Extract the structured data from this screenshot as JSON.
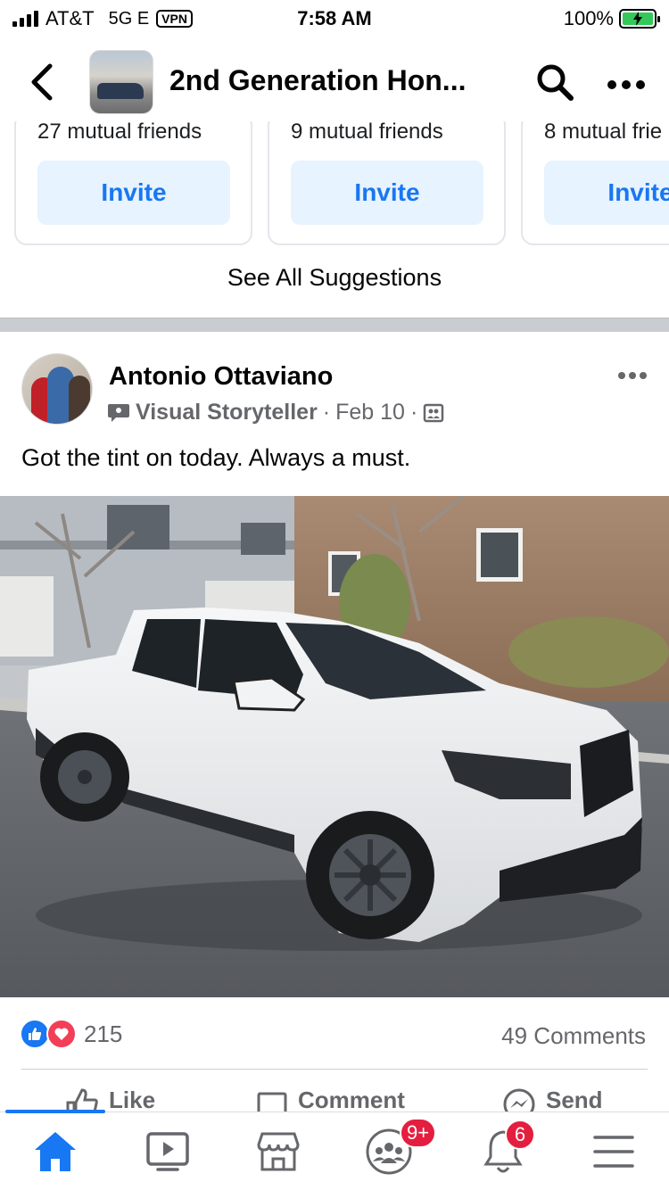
{
  "status_bar": {
    "carrier": "AT&T",
    "network": "5G E",
    "vpn": "VPN",
    "time": "7:58 AM",
    "battery": "100%"
  },
  "header": {
    "title": "2nd Generation Hon..."
  },
  "suggestions": {
    "cards": [
      {
        "mutual": "27 mutual friends",
        "invite_label": "Invite"
      },
      {
        "mutual": "9 mutual friends",
        "invite_label": "Invite"
      },
      {
        "mutual": "8 mutual frie",
        "invite_label": "Invite"
      }
    ],
    "see_all": "See All Suggestions"
  },
  "post": {
    "author": "Antonio Ottaviano",
    "badge": "Visual Storyteller",
    "date": "Feb 10",
    "text": "Got the tint on today. Always a must.",
    "reaction_count": "215",
    "comments": "49 Comments",
    "actions": {
      "like": "Like",
      "comment": "Comment",
      "send": "Send"
    }
  },
  "tabbar": {
    "groups_badge": "9+",
    "notifications_badge": "6"
  },
  "colors": {
    "accent": "#1877f2",
    "invite_bg": "#e7f3ff",
    "badge_red": "#e41e3f",
    "love": "#f33e58"
  }
}
